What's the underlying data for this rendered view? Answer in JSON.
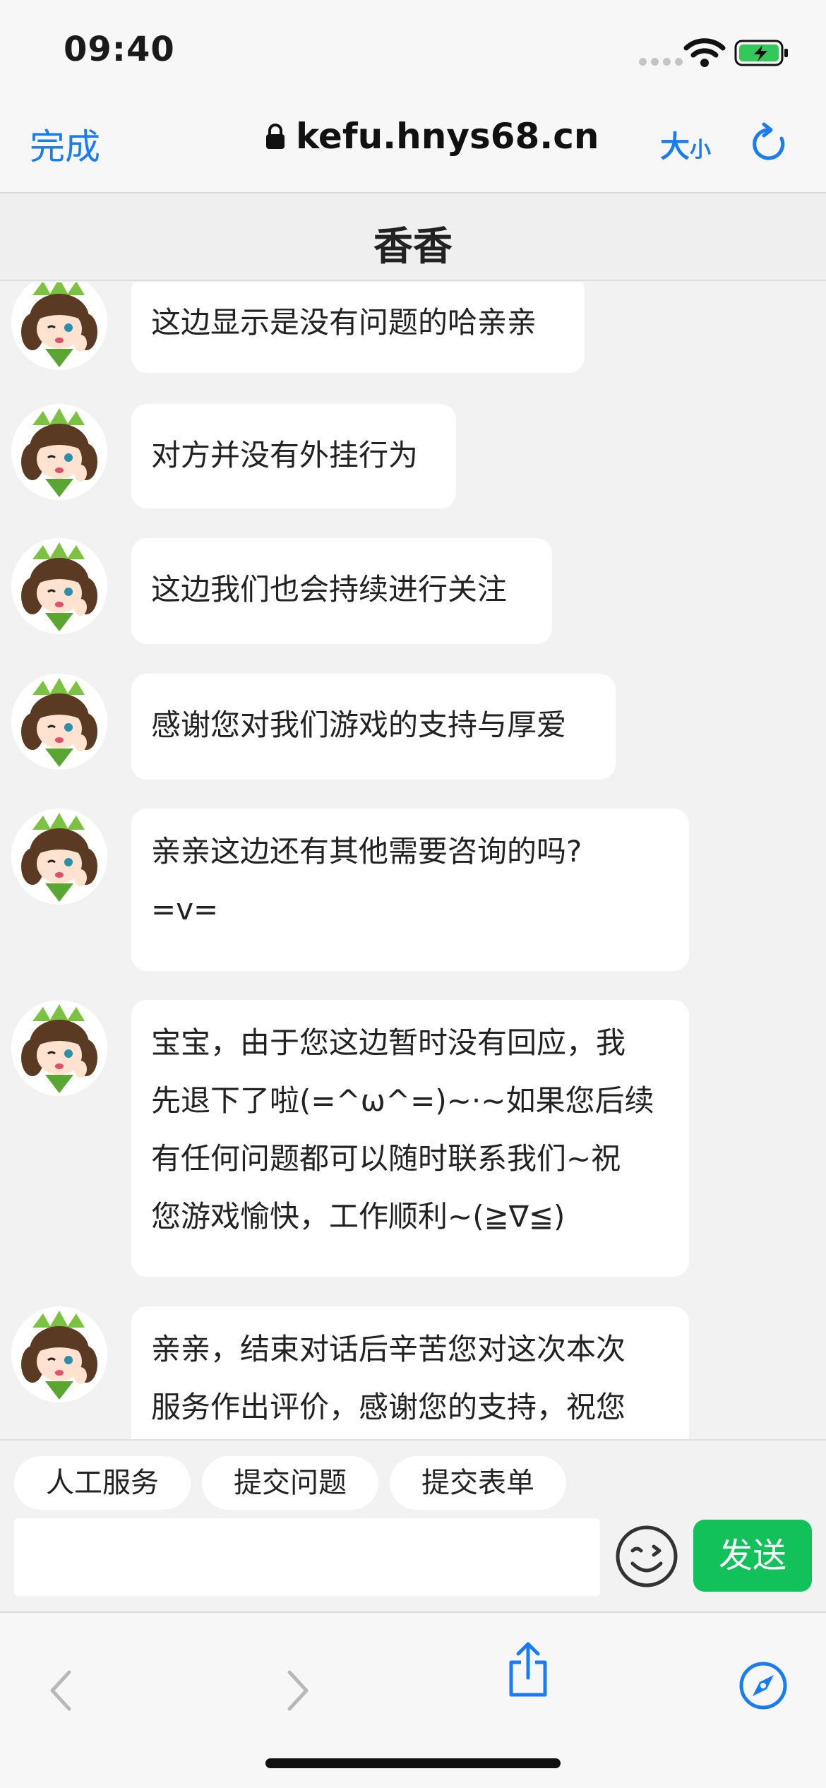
{
  "status_bar": {
    "time": "09:40"
  },
  "browser": {
    "done_label": "完成",
    "url": "kefu.hnys68.cn",
    "text_size_big": "大",
    "text_size_small": "小",
    "accent_color": "#1a7cf0"
  },
  "chat": {
    "title": "香香",
    "messages": [
      {
        "text": "这边显示是没有问题的哈亲亲"
      },
      {
        "text": "对方并没有外挂行为"
      },
      {
        "text": "这边我们也会持续进行关注"
      },
      {
        "text": "感谢您对我们游戏的支持与厚爱"
      },
      {
        "line1": "亲亲这边还有其他需要咨询的吗?",
        "line2": "=v="
      },
      {
        "line1": "宝宝，由于您这边暂时没有回应，我",
        "line2": "先退下了啦(=^ω^=)~·~如果您后续",
        "line3": "有任何问题都可以随时联系我们~祝",
        "line4": "您游戏愉快，工作顺利~(≧∇≦)"
      },
      {
        "line1": "亲亲，结束对话后辛苦您对这次本次",
        "line2": "服务作出评价，感谢您的支持，祝您"
      }
    ]
  },
  "quick_actions": [
    "人工服务",
    "提交问题",
    "提交表单"
  ],
  "composer": {
    "placeholder": "",
    "emoji_icon": "smiley-wink-icon",
    "send_label": "发送",
    "send_color": "#13c15b"
  },
  "toolbar": {
    "icons": [
      "back-arrow-icon",
      "forward-arrow-icon",
      "share-icon",
      "compass-icon"
    ]
  }
}
